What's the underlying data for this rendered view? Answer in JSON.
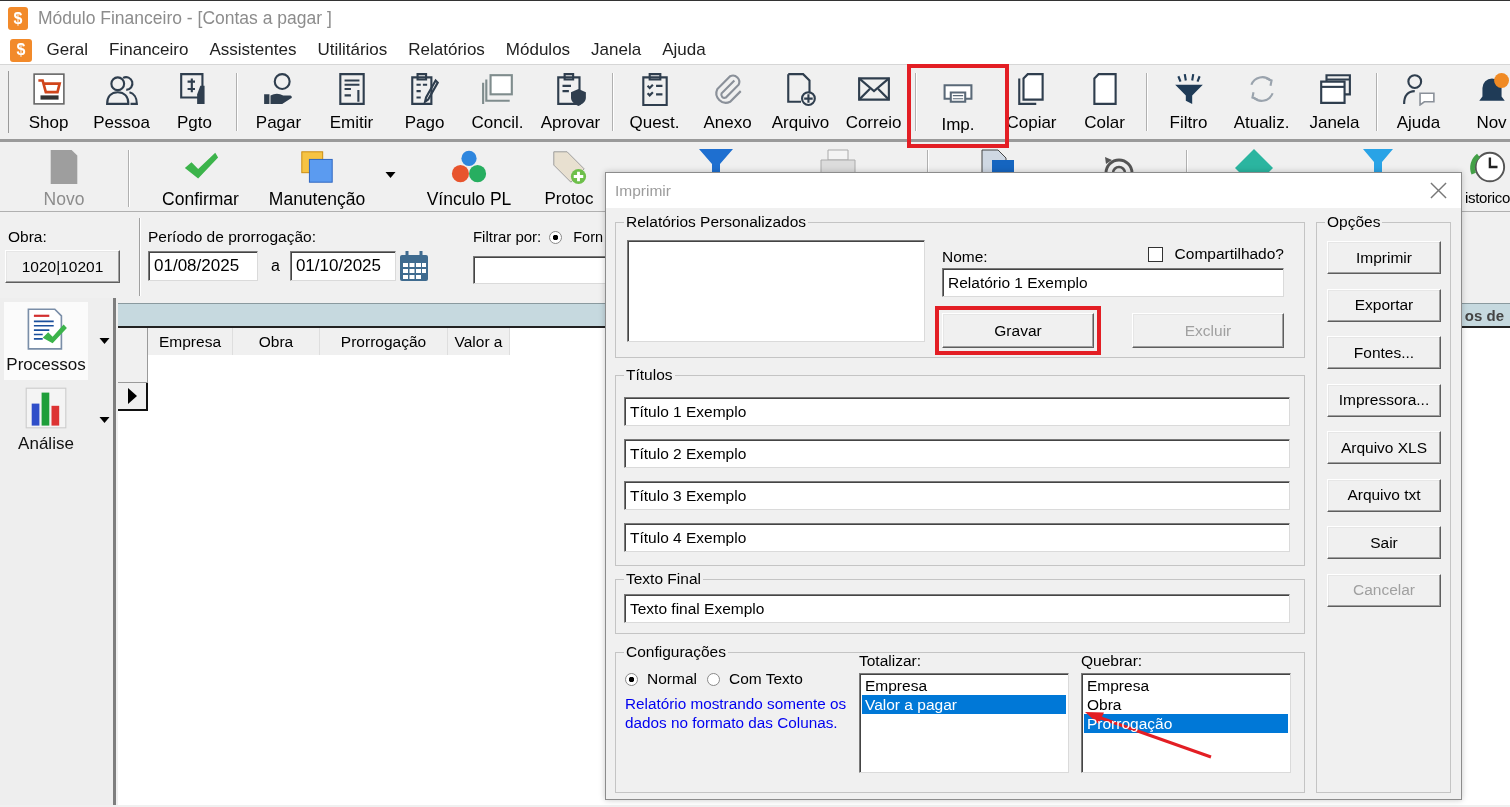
{
  "window": {
    "icon": "$",
    "title": "Módulo Financeiro - [Contas a pagar ]"
  },
  "menu": {
    "icon": "$",
    "items": [
      "Geral",
      "Financeiro",
      "Assistentes",
      "Utilitários",
      "Relatórios",
      "Módulos",
      "Janela",
      "Ajuda"
    ]
  },
  "toolbar": {
    "groups": [
      {
        "items": [
          {
            "label": "Shop",
            "highlighted": false
          },
          {
            "label": "Pessoa",
            "highlighted": false
          },
          {
            "label": "Pgto",
            "highlighted": false
          }
        ]
      },
      {
        "items": [
          {
            "label": "Pagar",
            "highlighted": false
          },
          {
            "label": "Emitir",
            "highlighted": false
          },
          {
            "label": "Pago",
            "highlighted": false
          },
          {
            "label": "Concil.",
            "highlighted": false
          },
          {
            "label": "Aprovar",
            "highlighted": false
          }
        ]
      },
      {
        "items": [
          {
            "label": "Quest.",
            "highlighted": false
          },
          {
            "label": "Anexo",
            "highlighted": false
          },
          {
            "label": "Arquivo",
            "highlighted": false
          },
          {
            "label": "Correio",
            "highlighted": false
          }
        ]
      },
      {
        "items": [
          {
            "label": "Imp.",
            "highlighted": true
          },
          {
            "label": "Copiar",
            "highlighted": false
          },
          {
            "label": "Colar",
            "highlighted": false
          }
        ]
      },
      {
        "items": [
          {
            "label": "Filtro",
            "highlighted": false
          },
          {
            "label": "Atualiz.",
            "highlighted": false
          },
          {
            "label": "Janela",
            "highlighted": false
          }
        ]
      },
      {
        "items": [
          {
            "label": "Ajuda",
            "highlighted": false
          },
          {
            "label": "Nov",
            "highlighted": false
          }
        ]
      }
    ]
  },
  "actions": {
    "groups": [
      {
        "items": [
          {
            "kind": "button",
            "label": "Novo",
            "disabled": true,
            "dropdown": false
          }
        ]
      },
      {
        "items": [
          {
            "kind": "button",
            "label": "Confirmar",
            "disabled": false,
            "dropdown": false
          },
          {
            "kind": "button",
            "label": "Manutenção",
            "disabled": false,
            "dropdown": true
          },
          {
            "kind": "button",
            "label": "Vínculo PL",
            "disabled": false,
            "dropdown": false
          },
          {
            "kind": "button",
            "label": "Protoc",
            "disabled": false,
            "dropdown": false
          },
          {
            "kind": "icon",
            "disabled": false
          },
          {
            "kind": "icon",
            "disabled": false
          }
        ]
      },
      {
        "items": [
          {
            "kind": "icon",
            "disabled": false
          },
          {
            "kind": "icon",
            "disabled": false
          }
        ]
      },
      {
        "items": [
          {
            "kind": "icon",
            "disabled": false
          },
          {
            "kind": "icon",
            "disabled": false
          },
          {
            "kind": "button",
            "label": "istorico",
            "disabled": false,
            "dropdown": false
          }
        ]
      }
    ]
  },
  "filters": {
    "obra": {
      "label": "Obra:",
      "value": "1020|10201"
    },
    "period": {
      "label": "Período de prorrogação:",
      "from": "01/08/2025",
      "separator": "a",
      "to": "01/10/2025"
    },
    "filter_by": {
      "label": "Filtrar por:",
      "options": [
        {
          "label": "Forn",
          "selected": true
        }
      ]
    }
  },
  "sidebar": {
    "items": [
      {
        "label": "Processos",
        "selected": true
      },
      {
        "label": "Análise",
        "selected": false
      }
    ]
  },
  "grid": {
    "banner": "os de",
    "columns": [
      "Empresa",
      "Obra",
      "Prorrogação",
      "Valor a"
    ],
    "rows": [
      {
        "current": false
      },
      {
        "current": true
      }
    ]
  },
  "dialog": {
    "title": "Imprimir",
    "custom_reports": {
      "title": "Relatórios Personalizados",
      "name_label": "Nome:",
      "name": "Relatório 1 Exemplo",
      "shared": {
        "label": "Compartilhado?",
        "checked": false
      },
      "buttons": [
        {
          "label": "Gravar",
          "disabled": false,
          "highlighted": true
        },
        {
          "label": "Excluir",
          "disabled": true,
          "highlighted": false
        }
      ]
    },
    "titles": {
      "title": "Títulos",
      "values": [
        "Título 1 Exemplo",
        "Título 2 Exemplo",
        "Título 3 Exemplo",
        "Título 4 Exemplo"
      ]
    },
    "final_text": {
      "title": "Texto Final",
      "value": "Texto final Exemplo"
    },
    "settings": {
      "title": "Configurações",
      "modes": [
        {
          "label": "Normal",
          "selected": true
        },
        {
          "label": "Com Texto",
          "selected": false
        }
      ],
      "note": "Relatório mostrando somente os dados no formato das Colunas.",
      "totalize": {
        "label": "Totalizar:",
        "items": [
          {
            "label": "Empresa",
            "selected": false
          },
          {
            "label": "Valor a pagar",
            "selected": true
          }
        ]
      },
      "break": {
        "label": "Quebrar:",
        "items": [
          {
            "label": "Empresa",
            "selected": false
          },
          {
            "label": "Obra",
            "selected": false
          },
          {
            "label": "Prorrogação",
            "selected": true
          }
        ]
      },
      "arrow": true
    },
    "options": {
      "title": "Opções",
      "buttons": [
        {
          "label": "Imprimir",
          "disabled": false
        },
        {
          "label": "Exportar",
          "disabled": false
        },
        {
          "label": "Fontes...",
          "disabled": false
        },
        {
          "label": "Impressora...",
          "disabled": false
        },
        {
          "label": "Arquivo XLS",
          "disabled": false
        },
        {
          "label": "Arquivo txt",
          "disabled": false
        },
        {
          "label": "Sair",
          "disabled": false
        },
        {
          "label": "Cancelar",
          "disabled": true
        }
      ]
    }
  }
}
